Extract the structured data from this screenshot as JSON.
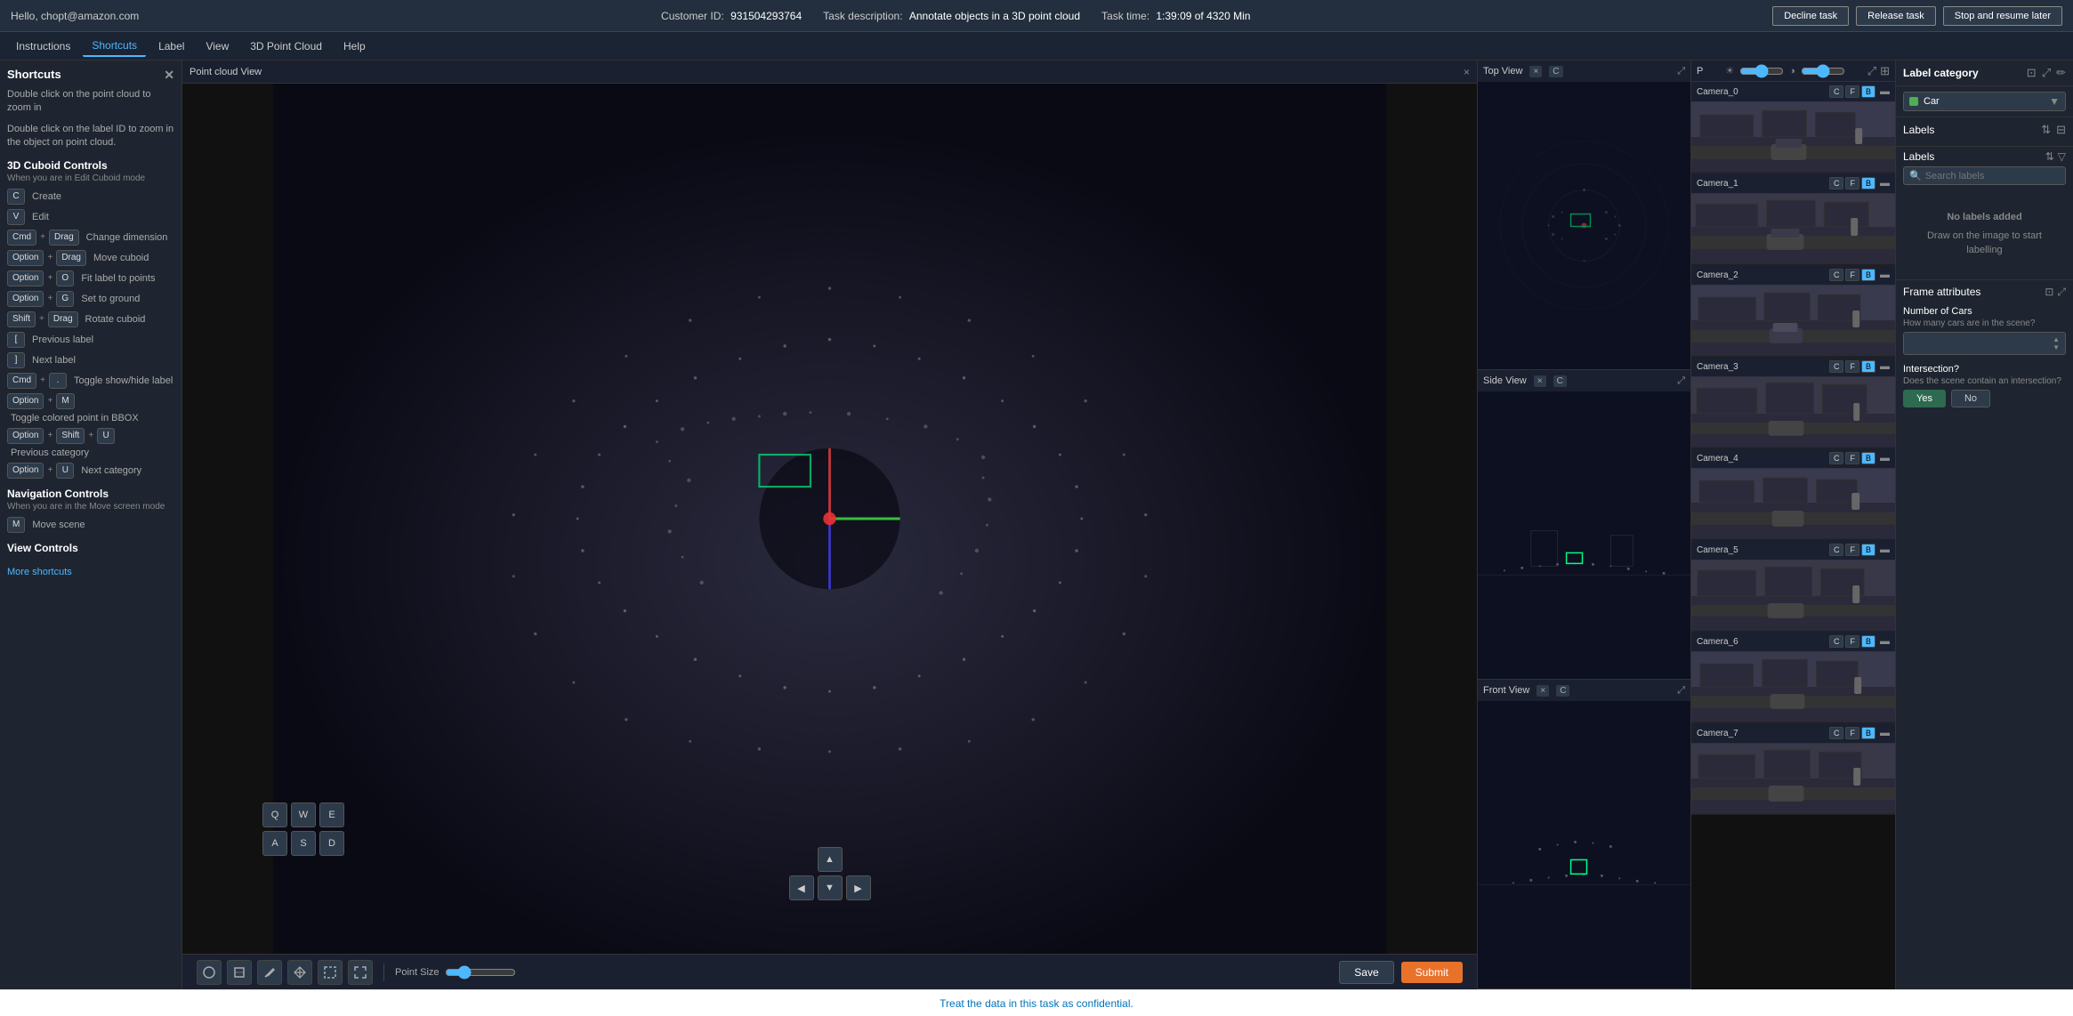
{
  "topbar": {
    "user": "Hello, chopt@amazon.com",
    "customer_id_label": "Customer ID:",
    "customer_id": "931504293764",
    "task_desc_label": "Task description:",
    "task_desc": "Annotate objects in a 3D point cloud",
    "task_time_label": "Task time:",
    "task_time": "1:39:09 of 4320 Min",
    "decline_btn": "Decline task",
    "release_btn": "Release task",
    "stop_btn": "Stop and resume later"
  },
  "menubar": {
    "items": [
      "Instructions",
      "Shortcuts",
      "Label",
      "View",
      "3D Point Cloud",
      "Help"
    ]
  },
  "sidebar": {
    "title": "Shortcuts",
    "intro1": "Double click on the point cloud to zoom in",
    "intro2": "Double click on the label ID to zoom in the object on point cloud.",
    "section_3d": "3D Cuboid Controls",
    "section_3d_note": "When you are in Edit Cuboid mode",
    "shortcuts_3d": [
      {
        "keys": [
          "C"
        ],
        "action": "Create"
      },
      {
        "keys": [
          "V"
        ],
        "action": "Edit"
      },
      {
        "keys": [
          "Cmd",
          "+",
          "Drag"
        ],
        "action": "Change dimension"
      },
      {
        "keys": [
          "Option",
          "+",
          "Drag"
        ],
        "action": "Move cuboid"
      },
      {
        "keys": [
          "Option",
          "+",
          "O"
        ],
        "action": "Fit label to points"
      },
      {
        "keys": [
          "Option",
          "+",
          "G"
        ],
        "action": "Set to ground"
      },
      {
        "keys": [
          "Shift",
          "+",
          "Drag"
        ],
        "action": "Rotate cuboid"
      },
      {
        "keys": [
          "["
        ],
        "action": "Previous label"
      },
      {
        "keys": [
          "]"
        ],
        "action": "Next label"
      },
      {
        "keys": [
          "Cmd",
          "+",
          "."
        ],
        "action": "Toggle show/hide label"
      },
      {
        "keys": [
          "Option",
          "+",
          "M"
        ],
        "action": "Toggle colored point in BBOX"
      },
      {
        "keys": [
          "Option",
          "+",
          "Shift",
          "+",
          "U"
        ],
        "action": "Previous category"
      },
      {
        "keys": [
          "Option",
          "+",
          "U"
        ],
        "action": "Next category"
      }
    ],
    "section_nav": "Navigation Controls",
    "section_nav_note": "When you are in the Move screen mode",
    "shortcuts_nav": [
      {
        "keys": [
          "M"
        ],
        "action": "Move scene"
      }
    ],
    "section_view": "View Controls",
    "more_shortcuts": "More shortcuts"
  },
  "pointcloud_panel": {
    "title": "Point cloud View",
    "close": "×"
  },
  "top_view": {
    "title": "Top View",
    "icon": "C",
    "close": "×"
  },
  "side_view": {
    "title": "Side View",
    "icon": "C",
    "close": "×"
  },
  "front_view": {
    "title": "Front View",
    "icon": "C",
    "close": "×"
  },
  "cameras": [
    {
      "id": "Camera_0",
      "btns": [
        "C",
        "F",
        "B"
      ]
    },
    {
      "id": "Camera_1",
      "btns": [
        "C",
        "F",
        "B"
      ]
    },
    {
      "id": "Camera_2",
      "btns": [
        "C",
        "F",
        "B"
      ]
    },
    {
      "id": "Camera_3",
      "btns": [
        "C",
        "F",
        "B"
      ]
    },
    {
      "id": "Camera_4",
      "btns": [
        "C",
        "F",
        "B"
      ]
    },
    {
      "id": "Camera_5",
      "btns": [
        "C",
        "F",
        "B"
      ]
    },
    {
      "id": "Camera_6",
      "btns": [
        "C",
        "F",
        "B"
      ]
    },
    {
      "id": "Camera_7",
      "btns": [
        "C",
        "F",
        "B"
      ]
    }
  ],
  "label_panel": {
    "title": "Label category",
    "selected": "Car",
    "labels_title": "Labels",
    "search_placeholder": "Search labels",
    "no_labels_line1": "No labels added",
    "no_labels_line2": "Draw on the image to start labelling",
    "frame_attrs_title": "Frame attributes",
    "attrs": [
      {
        "label": "Number of Cars",
        "desc": "How many cars are in the scene?",
        "type": "number",
        "value": ""
      },
      {
        "label": "Intersection?",
        "desc": "Does the scene contain an intersection?",
        "type": "yesno",
        "yes": "Yes",
        "no": "No",
        "selected": "Yes"
      }
    ]
  },
  "toolbar": {
    "point_size_label": "Point Size",
    "save_btn": "Save",
    "submit_btn": "Submit",
    "nav_keys": [
      "Q",
      "W",
      "E",
      "A",
      "S",
      "D"
    ]
  },
  "statusbar": {
    "text": "Treat the data in this task as confidential."
  }
}
